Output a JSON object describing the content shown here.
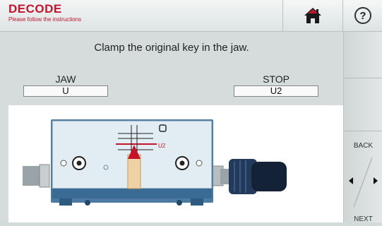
{
  "header": {
    "title": "DECODE",
    "subtitle": "Please follow the instructions",
    "home_icon": "home-icon",
    "help_glyph": "?"
  },
  "main": {
    "instruction": "Clamp the original key in the jaw.",
    "jaw": {
      "label": "JAW",
      "value": "U"
    },
    "stop": {
      "label": "STOP",
      "value": "U2"
    },
    "diagram": {
      "marker_label": "U2"
    }
  },
  "side": {
    "back_label": "BACK",
    "next_label": "NEXT"
  },
  "colors": {
    "brand_red": "#c4142c",
    "jaw_blue": "#3a6b94",
    "knob_navy": "#243a5a"
  }
}
